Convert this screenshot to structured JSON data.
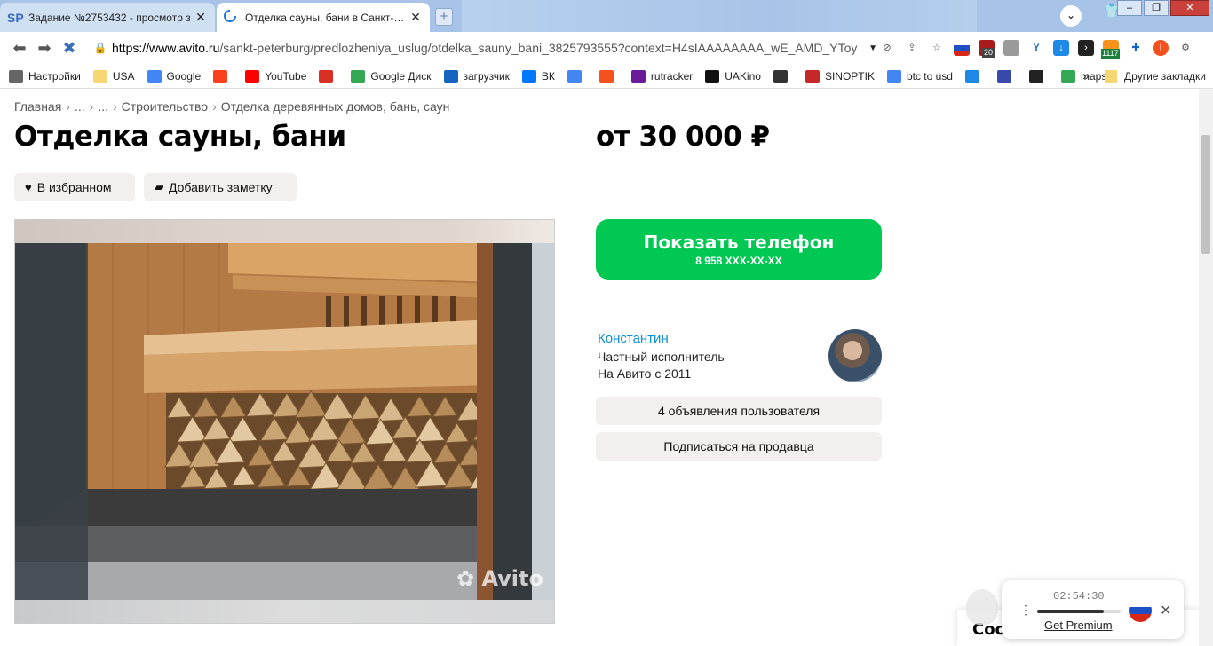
{
  "browser": {
    "tabs": [
      {
        "favicon": "SP",
        "title": "Задание №2753432 - просмотр з",
        "close": "✕"
      },
      {
        "favicon": "loading-spinner",
        "title": "Отделка сауны, бани в Санкт-Пет",
        "close": "✕"
      }
    ],
    "url_host": "https://www.avito.ru",
    "url_path": "/sankt-peterburg/predlozheniya_uslug/otdelka_sauny_bani_3825793555?context=H4sIAAAAAAAA_wE_AMD_YToy",
    "ext_badge_1": "20",
    "ext_badge_2": "1117",
    "ext_profile_letter": "I",
    "bookmarks": [
      {
        "label": "Настройки",
        "icon": "gear-icon"
      },
      {
        "label": "USA",
        "icon": "folder-icon"
      },
      {
        "label": "Google",
        "icon": "google-icon"
      },
      {
        "label": "",
        "icon": "yandex-icon"
      },
      {
        "label": "YouTube",
        "icon": "youtube-icon"
      },
      {
        "label": "",
        "icon": "gmail-icon"
      },
      {
        "label": "Google Диск",
        "icon": "drive-icon"
      },
      {
        "label": "загрузчик",
        "icon": "infinity-icon"
      },
      {
        "label": "ВК",
        "icon": "vk-icon"
      },
      {
        "label": "",
        "icon": "translate-icon"
      },
      {
        "label": "",
        "icon": "f-icon"
      },
      {
        "label": "rutracker",
        "icon": "star-icon"
      },
      {
        "label": "UAKino",
        "icon": "film-icon"
      },
      {
        "label": "",
        "icon": "figure-icon"
      },
      {
        "label": "SINOPTIK",
        "icon": "thermometer-icon"
      },
      {
        "label": "btc to usd",
        "icon": "google-icon"
      },
      {
        "label": "",
        "icon": "p-icon"
      },
      {
        "label": "",
        "icon": "arrow-icon"
      },
      {
        "label": "",
        "icon": "bc-icon"
      },
      {
        "label": "maps",
        "icon": "maps-icon"
      }
    ],
    "bookmarks_more": "»",
    "other_bookmarks": "Другие закладки"
  },
  "page": {
    "breadcrumbs": [
      "Главная",
      "...",
      "...",
      "Строительство",
      "Отделка деревянных домов, бань, саун"
    ],
    "title": "Отделка сауны, бани",
    "price": "от 30 000 ₽",
    "favorite_label": "В избранном",
    "note_label": "Добавить заметку",
    "photo_watermark": "Avito",
    "phone_button": {
      "label": "Показать телефон",
      "number": "8 958 XXX-XX-XX"
    },
    "seller": {
      "name": "Константин",
      "type": "Частный исполнитель",
      "since": "На Авито с 2011"
    },
    "user_ads_label": "4 объявления пользователя",
    "subscribe_label": "Подписаться на продавца",
    "cookie_text": "Coo"
  },
  "premium_widget": {
    "time": "02:54:30",
    "progress": 0.8,
    "link": "Get Premium",
    "flag_colors": [
      "#ffffff",
      "#1e4fc4",
      "#d62718"
    ]
  },
  "colors": {
    "accent_green": "#00c853",
    "link_blue": "#0a8ed7",
    "button_gray": "#f1f0ee"
  }
}
